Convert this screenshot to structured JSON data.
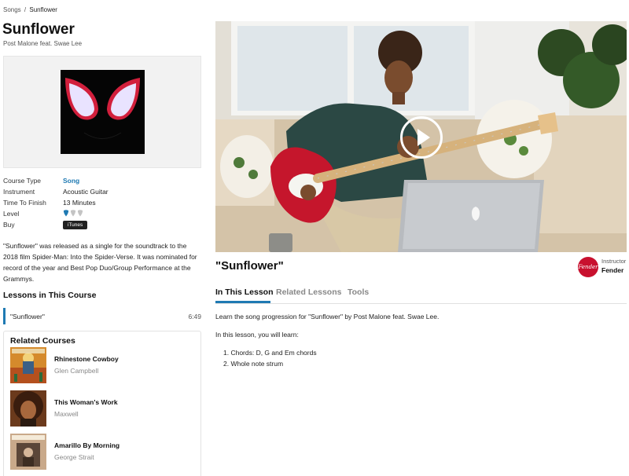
{
  "breadcrumb": {
    "parent": "Songs",
    "separator": "/",
    "current": "Sunflower"
  },
  "song": {
    "title": "Sunflower",
    "artist": "Post Malone feat. Swae Lee"
  },
  "meta": {
    "course_type": {
      "key": "Course Type",
      "value": "Song"
    },
    "instrument": {
      "key": "Instrument",
      "value": "Acoustic Guitar"
    },
    "time_to_finish": {
      "key": "Time To Finish",
      "value": "13 Minutes"
    },
    "level": {
      "key": "Level",
      "filled": 1,
      "total": 3
    },
    "buy": {
      "key": "Buy",
      "button": "iTunes"
    }
  },
  "description": "\"Sunflower\" was released as a single for the soundtrack to the 2018 film Spider-Man: Into the Spider-Verse. It was nominated for record of the year and Best Pop Duo/Group Performance at the Grammys.",
  "lessons_in_course": {
    "heading": "Lessons in This Course",
    "items": [
      {
        "name": "\"Sunflower\"",
        "duration": "6:49"
      }
    ]
  },
  "related_courses": {
    "heading": "Related Courses",
    "items": [
      {
        "title": "Rhinestone Cowboy",
        "artist": "Glen Campbell"
      },
      {
        "title": "This Woman's Work",
        "artist": "Maxwell"
      },
      {
        "title": "Amarillo By Morning",
        "artist": "George Strait"
      }
    ]
  },
  "lesson": {
    "title": "\"Sunflower\"",
    "instructor_label": "Instructor",
    "instructor_name": "Fender",
    "tabs": [
      "In This Lesson",
      "Related Lessons",
      "Tools"
    ],
    "intro": "Learn the song progression for \"Sunflower\" by Post Malone feat. Swae Lee.",
    "learn_heading": "In this lesson, you will learn:",
    "learn_items": [
      "1. Chords: D, G and Em chords",
      "2. Whole note strum"
    ]
  },
  "colors": {
    "accent": "#1f7ab3",
    "fender_red": "#c8102e"
  }
}
